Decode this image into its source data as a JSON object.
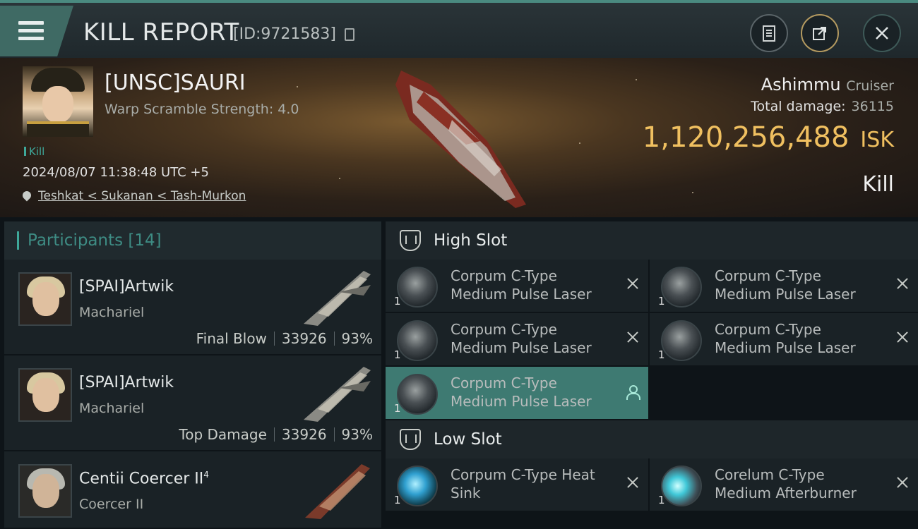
{
  "header": {
    "title": "KILL REPORT",
    "report_id": "[ID:9721583]"
  },
  "victim": {
    "name": "[UNSC]SAURI",
    "warp_scramble": "Warp Scramble Strength: 4.0",
    "kill_tag": "Kill",
    "timestamp": "2024/08/07 11:38:48 UTC +5",
    "location": "Teshkat < Sukanan < Tash-Murkon"
  },
  "ship": {
    "name": "Ashimmu",
    "class": "Cruiser",
    "total_damage_label": "Total damage:",
    "total_damage": "36115",
    "isk_value": "1,120,256,488",
    "isk_unit": "ISK",
    "result": "Kill"
  },
  "participants": {
    "label": "Participants",
    "count": "[14]",
    "rows": [
      {
        "name": "[SPAI]Artwik",
        "ship": "Machariel",
        "role": "Final Blow",
        "damage": "33926",
        "percent": "93%"
      },
      {
        "name": "[SPAI]Artwik",
        "ship": "Machariel",
        "role": "Top Damage",
        "damage": "33926",
        "percent": "93%"
      },
      {
        "name": "Centii Coercer II",
        "sup": "4",
        "ship": "Coercer II"
      }
    ]
  },
  "high_slot": {
    "label": "High Slot",
    "items": [
      {
        "line1": "Corpum C-Type",
        "line2": "Medium Pulse Laser",
        "qty": "1"
      },
      {
        "line1": "Corpum C-Type",
        "line2": "Medium Pulse Laser",
        "qty": "1"
      },
      {
        "line1": "Corpum C-Type",
        "line2": "Medium Pulse Laser",
        "qty": "1"
      },
      {
        "line1": "Corpum C-Type",
        "line2": "Medium Pulse Laser",
        "qty": "1"
      },
      {
        "line1": "Corpum C-Type",
        "line2": "Medium Pulse Laser",
        "qty": "1"
      }
    ]
  },
  "low_slot": {
    "label": "Low Slot",
    "items": [
      {
        "line1": "Corpum C-Type Heat",
        "line2": "Sink",
        "qty": "1"
      },
      {
        "line1": "Corelum C-Type",
        "line2": "Medium Afterburner",
        "qty": "1"
      }
    ]
  }
}
